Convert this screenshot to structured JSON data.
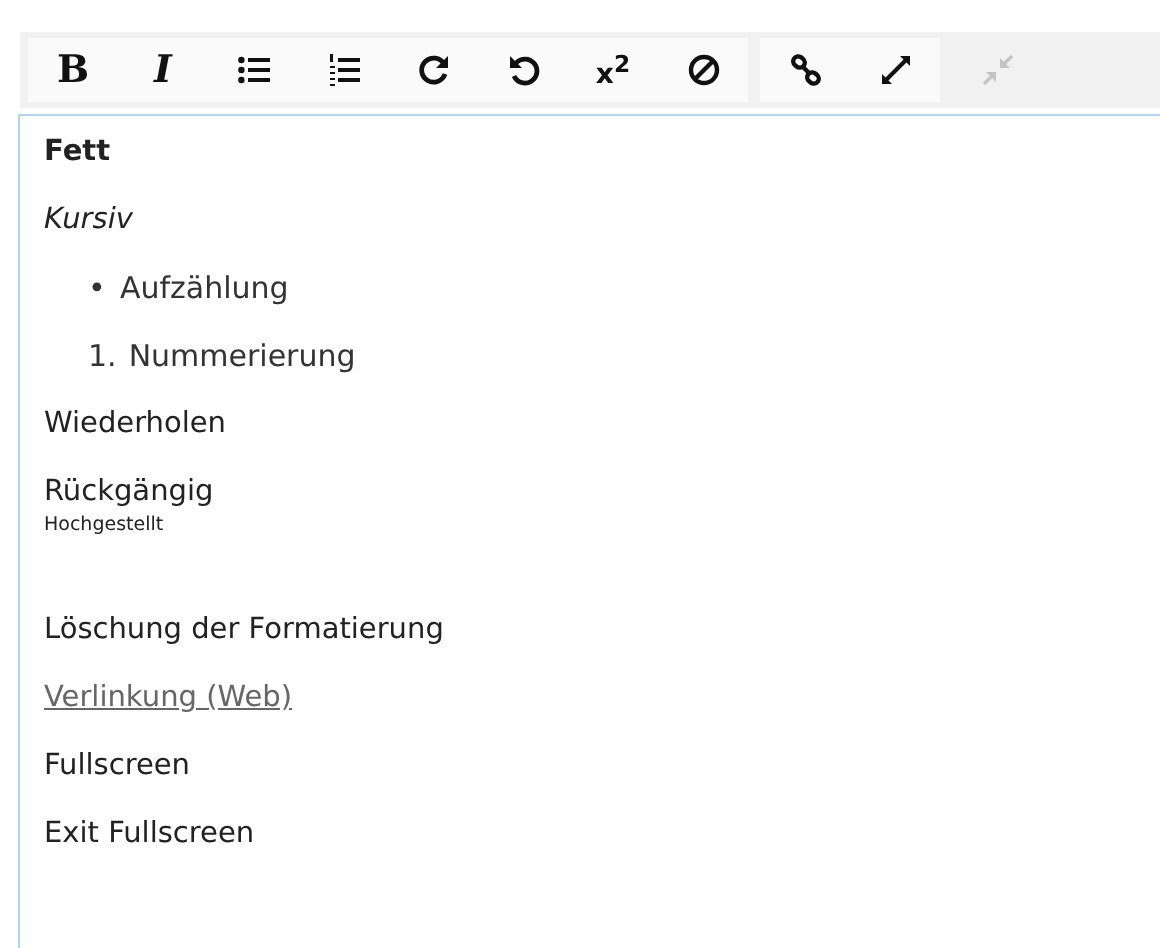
{
  "toolbar": {
    "groups": [
      {
        "buttons": [
          {
            "kind": "bold",
            "label": "B",
            "disabled": false
          },
          {
            "kind": "italic",
            "label": "I",
            "disabled": false
          },
          {
            "kind": "bullets",
            "disabled": false
          },
          {
            "kind": "numbers",
            "disabled": false
          },
          {
            "kind": "redo",
            "disabled": false
          },
          {
            "kind": "undo",
            "disabled": false
          },
          {
            "kind": "superscript",
            "label": "x$^{2}$",
            "disabled": false
          },
          {
            "kind": "clear",
            "disabled": false
          }
        ]
      },
      {
        "buttons": [
          {
            "kind": "link",
            "disabled": false
          },
          {
            "kind": "expand",
            "disabled": false
          }
        ]
      },
      {
        "buttons": [
          {
            "kind": "compress",
            "disabled": true
          }
        ]
      }
    ]
  },
  "editor": {
    "paragraphs": [
      {
        "kind": "bold",
        "text": "Fett"
      },
      {
        "kind": "italic",
        "text": "Kursiv"
      },
      {
        "kind": "bullet",
        "marker": "•",
        "text": "Aufzählung"
      },
      {
        "kind": "numbered",
        "marker": "1.",
        "text": "Nummerierung"
      },
      {
        "kind": "plain",
        "text": "Wiederholen"
      },
      {
        "kind": "plain",
        "text": "Rückgängig"
      },
      {
        "kind": "small",
        "text": "Hochgestellt"
      },
      {
        "kind": "plain",
        "text": "Löschung der Formatierung"
      },
      {
        "kind": "link",
        "text": "Verlinkung (Web)"
      },
      {
        "kind": "plain",
        "text": "Fullscreen"
      },
      {
        "kind": "plain",
        "text": "Exit Fullscreen"
      }
    ]
  }
}
